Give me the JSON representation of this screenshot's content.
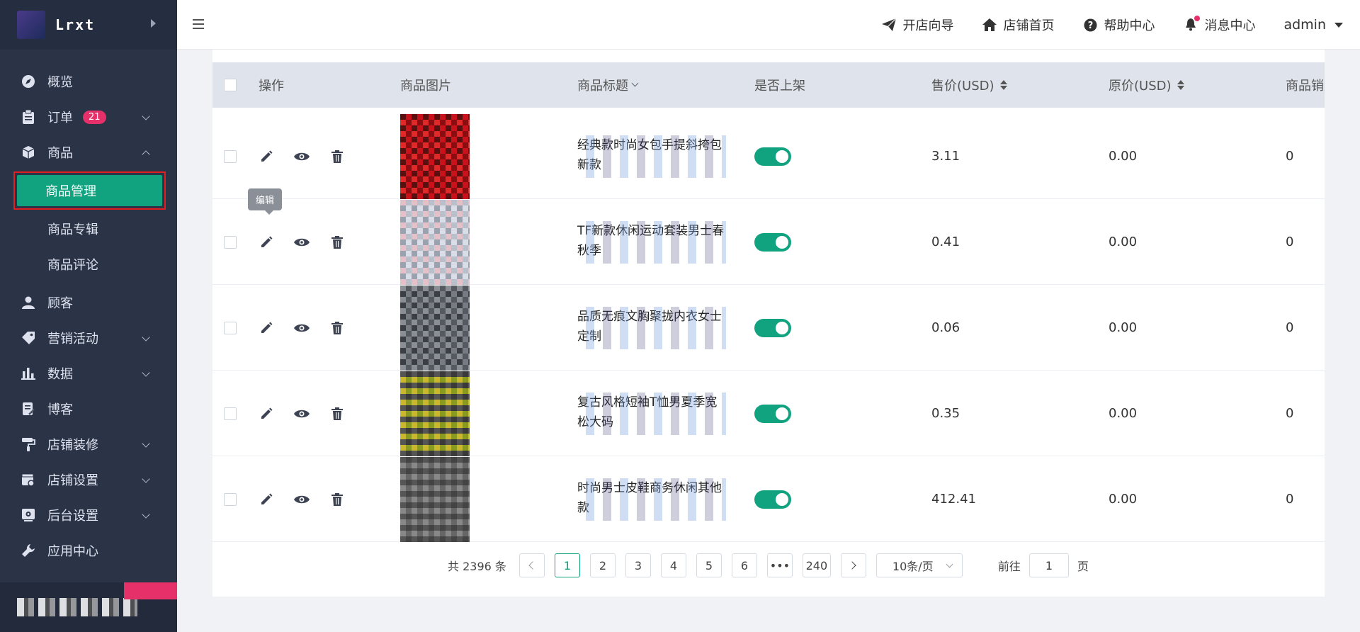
{
  "sidebar": {
    "logo_text": "Lrxt",
    "menu": [
      {
        "label": "概览",
        "icon": "compass-icon"
      },
      {
        "label": "订单",
        "icon": "clipboard-icon",
        "badge": "21"
      },
      {
        "label": "商品",
        "icon": "cube-icon"
      }
    ],
    "submenu": {
      "active": "商品管理",
      "items": [
        "商品专辑",
        "商品评论"
      ]
    },
    "menu2": [
      {
        "label": "顾客",
        "icon": "user-icon"
      },
      {
        "label": "营销活动",
        "icon": "tag-icon"
      },
      {
        "label": "数据",
        "icon": "bar-chart-icon"
      },
      {
        "label": "博客",
        "icon": "edit-doc-icon"
      },
      {
        "label": "店铺装修",
        "icon": "paint-roller-icon"
      },
      {
        "label": "店铺设置",
        "icon": "store-settings-icon"
      },
      {
        "label": "后台设置",
        "icon": "settings-box-icon"
      },
      {
        "label": "应用中心",
        "icon": "wrench-icon"
      }
    ]
  },
  "topbar": {
    "links": [
      {
        "label": "开店向导",
        "icon": "paper-plane-icon"
      },
      {
        "label": "店铺首页",
        "icon": "home-icon"
      },
      {
        "label": "帮助中心",
        "icon": "help-circle-icon"
      },
      {
        "label": "消息中心",
        "icon": "bell-icon"
      }
    ],
    "user": "admin"
  },
  "table": {
    "headers": {
      "action": "操作",
      "image": "商品图片",
      "title": "商品标题",
      "listed": "是否上架",
      "price": "售价(USD)",
      "original": "原价(USD)",
      "sales": "商品销量"
    },
    "rows": [
      {
        "title": "经典款时尚女包手提斜挎包新款",
        "price": "3.11",
        "original": "0.00",
        "sales": "0",
        "listed": true
      },
      {
        "title": "TF新款休闲运动套装男士春秋季",
        "price": "0.41",
        "original": "0.00",
        "sales": "0",
        "listed": true
      },
      {
        "title": "品质无痕文胸聚拢内衣女士定制",
        "price": "0.06",
        "original": "0.00",
        "sales": "0",
        "listed": true
      },
      {
        "title": "复古风格短袖T恤男夏季宽松大码",
        "price": "0.35",
        "original": "0.00",
        "sales": "0",
        "listed": true
      },
      {
        "title": "时尚男士皮鞋商务休闲其他款",
        "price": "412.41",
        "original": "0.00",
        "sales": "0",
        "listed": true
      }
    ],
    "tooltip": "编辑"
  },
  "pagination": {
    "total": "共 2396 条",
    "pages": [
      "1",
      "2",
      "3",
      "4",
      "5",
      "6",
      "•••",
      "240"
    ],
    "page_size": "10条/页",
    "goto_label": "前往",
    "goto_value": "1",
    "page_unit": "页"
  },
  "colors": {
    "sidebar_bg": "#2b3347",
    "accent": "#11a37f",
    "badge": "#e6306a"
  }
}
